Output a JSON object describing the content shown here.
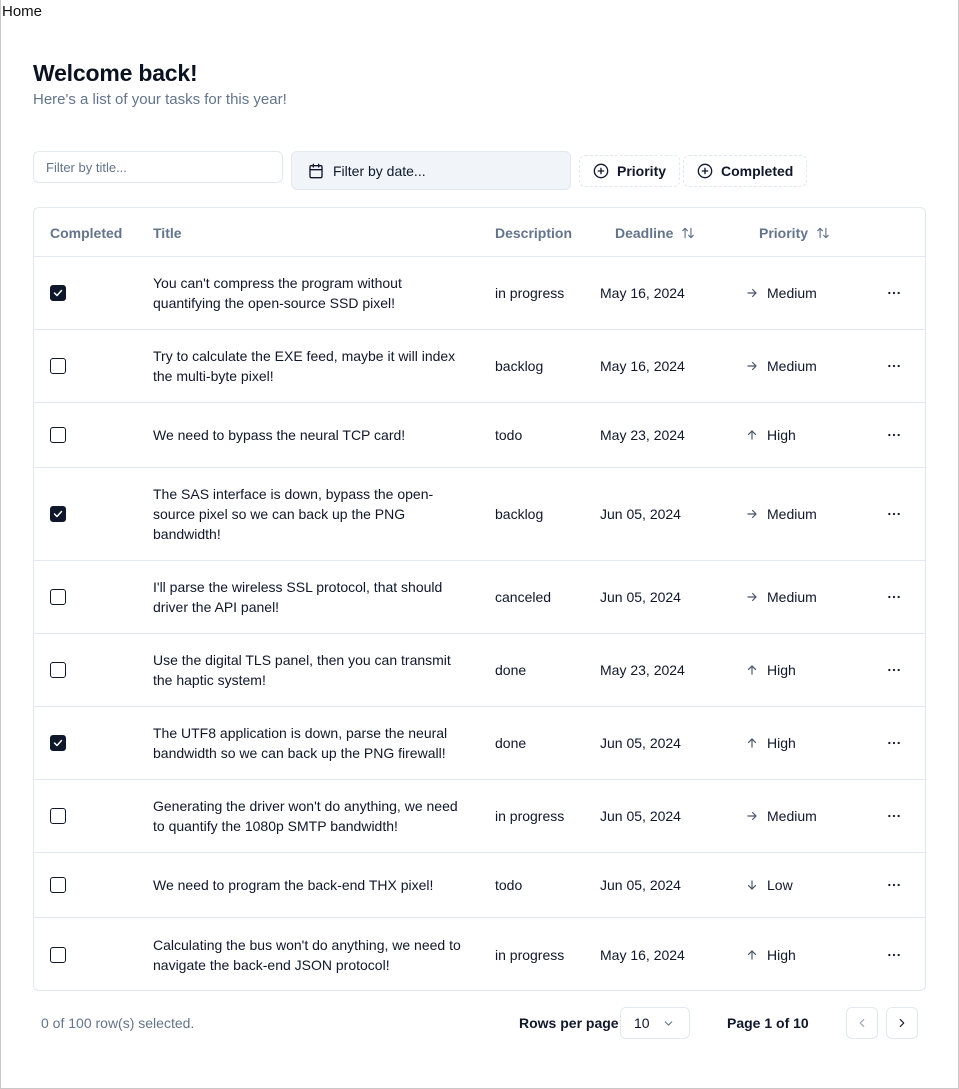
{
  "nav": {
    "home_label": "Home"
  },
  "header": {
    "title": "Welcome back!",
    "subtitle": "Here's a list of your tasks for this year!"
  },
  "toolbar": {
    "filter_title_placeholder": "Filter by title...",
    "filter_date_label": "Filter by date...",
    "priority_filter_label": "Priority",
    "completed_filter_label": "Completed"
  },
  "table": {
    "columns": {
      "completed": "Completed",
      "title": "Title",
      "description": "Description",
      "deadline": "Deadline",
      "priority": "Priority"
    },
    "rows": [
      {
        "completed": true,
        "title": "You can't compress the program without quantifying the open-source SSD pixel!",
        "description": "in progress",
        "deadline": "May 16, 2024",
        "priority": "Medium",
        "priority_icon": "arrow-right-icon"
      },
      {
        "completed": false,
        "title": "Try to calculate the EXE feed, maybe it will index the multi-byte pixel!",
        "description": "backlog",
        "deadline": "May 16, 2024",
        "priority": "Medium",
        "priority_icon": "arrow-right-icon"
      },
      {
        "completed": false,
        "title": "We need to bypass the neural TCP card!",
        "description": "todo",
        "deadline": "May 23, 2024",
        "priority": "High",
        "priority_icon": "arrow-up-icon"
      },
      {
        "completed": true,
        "title": "The SAS interface is down, bypass the open-source pixel so we can back up the PNG bandwidth!",
        "description": "backlog",
        "deadline": "Jun 05, 2024",
        "priority": "Medium",
        "priority_icon": "arrow-right-icon"
      },
      {
        "completed": false,
        "title": "I'll parse the wireless SSL protocol, that should driver the API panel!",
        "description": "canceled",
        "deadline": "Jun 05, 2024",
        "priority": "Medium",
        "priority_icon": "arrow-right-icon"
      },
      {
        "completed": false,
        "title": "Use the digital TLS panel, then you can transmit the haptic system!",
        "description": "done",
        "deadline": "May 23, 2024",
        "priority": "High",
        "priority_icon": "arrow-up-icon"
      },
      {
        "completed": true,
        "title": "The UTF8 application is down, parse the neural bandwidth so we can back up the PNG firewall!",
        "description": "done",
        "deadline": "Jun 05, 2024",
        "priority": "High",
        "priority_icon": "arrow-up-icon"
      },
      {
        "completed": false,
        "title": "Generating the driver won't do anything, we need to quantify the 1080p SMTP bandwidth!",
        "description": "in progress",
        "deadline": "Jun 05, 2024",
        "priority": "Medium",
        "priority_icon": "arrow-right-icon"
      },
      {
        "completed": false,
        "title": "We need to program the back-end THX pixel!",
        "description": "todo",
        "deadline": "Jun 05, 2024",
        "priority": "Low",
        "priority_icon": "arrow-down-icon"
      },
      {
        "completed": false,
        "title": "Calculating the bus won't do anything, we need to navigate the back-end JSON protocol!",
        "description": "in progress",
        "deadline": "May 16, 2024",
        "priority": "High",
        "priority_icon": "arrow-up-icon"
      }
    ]
  },
  "footer": {
    "selection_text": "0 of 100 row(s) selected.",
    "rows_per_page_label": "Rows per page",
    "rows_per_page_value": "10",
    "page_info": "Page 1 of 10"
  }
}
